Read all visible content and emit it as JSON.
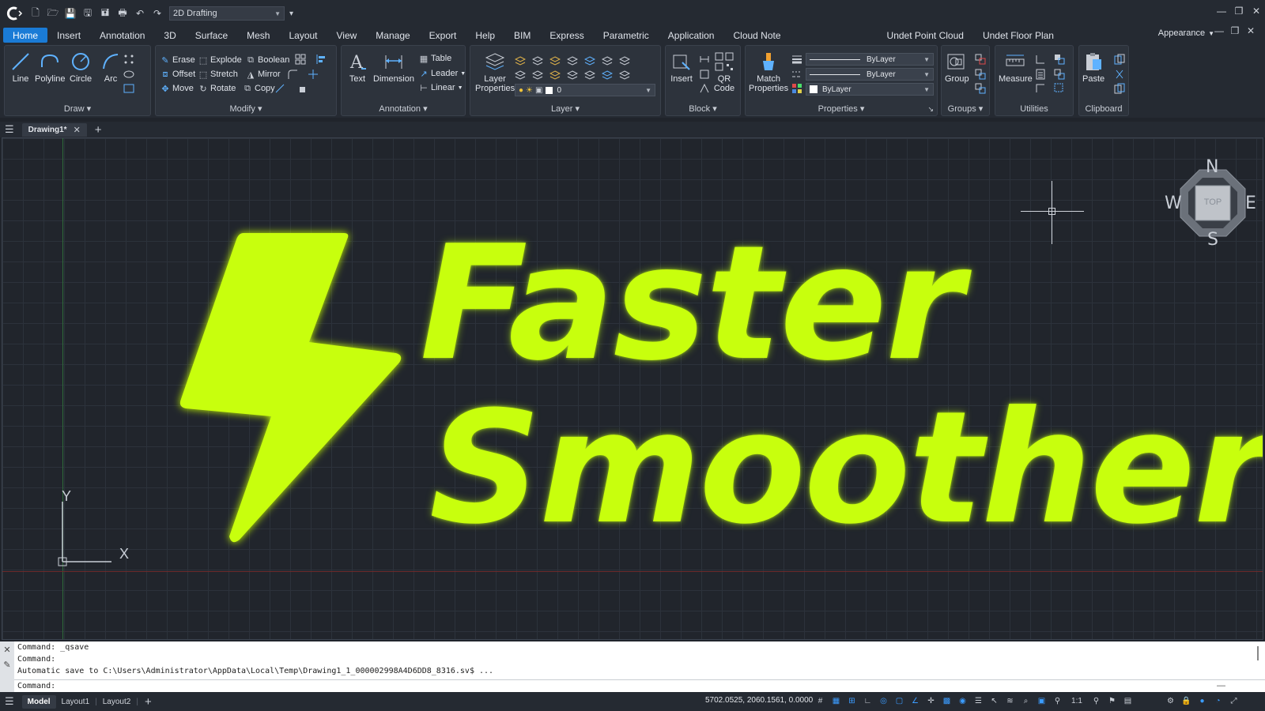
{
  "titlebar": {
    "workspace": "2D Drafting",
    "window_controls": [
      "—",
      "❐",
      "✕"
    ]
  },
  "menu": {
    "tabs": [
      "Home",
      "Insert",
      "Annotation",
      "3D",
      "Surface",
      "Mesh",
      "Layout",
      "View",
      "Manage",
      "Export",
      "Help",
      "BIM",
      "Express",
      "Parametric",
      "Application",
      "Cloud Note",
      "Undet Point Cloud",
      "Undet Floor Plan"
    ],
    "appearance": "Appearance"
  },
  "ribbon": {
    "draw": {
      "title": "Draw",
      "line": "Line",
      "polyline": "Polyline",
      "circle": "Circle",
      "arc": "Arc"
    },
    "modify": {
      "title": "Modify",
      "erase": "Erase",
      "explode": "Explode",
      "boolean": "Boolean",
      "offset": "Offset",
      "stretch": "Stretch",
      "mirror": "Mirror",
      "move": "Move",
      "rotate": "Rotate",
      "copy": "Copy"
    },
    "annotation": {
      "title": "Annotation",
      "text": "Text",
      "dimension": "Dimension",
      "table": "Table",
      "leader": "Leader",
      "linear": "Linear"
    },
    "layer": {
      "title": "Layer",
      "layer_properties_1": "Layer",
      "layer_properties_2": "Properties",
      "current_layer": "0"
    },
    "block": {
      "title": "Block",
      "insert": "Insert",
      "qr_code_1": "QR",
      "qr_code_2": "Code"
    },
    "properties": {
      "title": "Properties",
      "match_1": "Match",
      "match_2": "Properties",
      "linetype": "ByLayer",
      "lineweight": "ByLayer",
      "color": "ByLayer"
    },
    "groups": {
      "title": "Groups",
      "group": "Group"
    },
    "utilities": {
      "title": "Utilities",
      "measure": "Measure"
    },
    "clipboard": {
      "title": "Clipboard",
      "paste": "Paste"
    }
  },
  "document": {
    "tab": "Drawing1*"
  },
  "canvas": {
    "line1": "Faster",
    "line2": "Smoother",
    "viewcube": {
      "n": "N",
      "s": "S",
      "e": "E",
      "w": "W",
      "face": "TOP"
    },
    "ucs_x": "X",
    "ucs_y": "Y",
    "accent_color": "#c8ff0d"
  },
  "command": {
    "line1": "Command: _qsave",
    "line2": "Command:",
    "line3": "Automatic save to C:\\Users\\Administrator\\AppData\\Local\\Temp\\Drawing1_1_000002998A4D6DD8_8316.sv$ ...",
    "prompt": "Command:"
  },
  "status": {
    "tabs": [
      "Model",
      "Layout1",
      "Layout2"
    ],
    "coords": "5702.0525, 2060.1561, 0.0000",
    "scale": "1:1"
  }
}
